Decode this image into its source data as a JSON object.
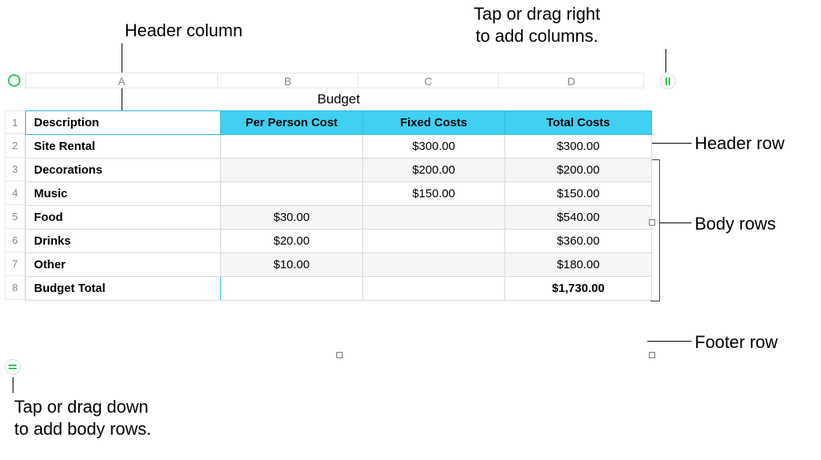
{
  "callouts": {
    "header_column": "Header column",
    "add_columns": "Tap or drag right\nto add columns.",
    "header_row": "Header row",
    "body_rows": "Body rows",
    "footer_row": "Footer row",
    "add_body_rows": "Tap or drag down\nto add body rows."
  },
  "column_letters": [
    "A",
    "B",
    "C",
    "D"
  ],
  "row_numbers": [
    "1",
    "2",
    "3",
    "4",
    "5",
    "6",
    "7",
    "8"
  ],
  "table": {
    "title": "Budget",
    "headers": {
      "description": "Description",
      "per_person": "Per Person Cost",
      "fixed": "Fixed Costs",
      "total": "Total Costs"
    },
    "rows": [
      {
        "desc": "Site Rental",
        "per_person": "",
        "fixed": "$300.00",
        "total": "$300.00"
      },
      {
        "desc": "Decorations",
        "per_person": "",
        "fixed": "$200.00",
        "total": "$200.00"
      },
      {
        "desc": "Music",
        "per_person": "",
        "fixed": "$150.00",
        "total": "$150.00"
      },
      {
        "desc": "Food",
        "per_person": "$30.00",
        "fixed": "",
        "total": "$540.00"
      },
      {
        "desc": "Drinks",
        "per_person": "$20.00",
        "fixed": "",
        "total": "$360.00"
      },
      {
        "desc": "Other",
        "per_person": "$10.00",
        "fixed": "",
        "total": "$180.00"
      }
    ],
    "footer": {
      "desc": "Budget Total",
      "per_person": "",
      "fixed": "",
      "total": "$1,730.00"
    }
  },
  "chart_data": {
    "type": "table",
    "title": "Budget",
    "columns": [
      "Description",
      "Per Person Cost",
      "Fixed Costs",
      "Total Costs"
    ],
    "rows": [
      [
        "Site Rental",
        null,
        300.0,
        300.0
      ],
      [
        "Decorations",
        null,
        200.0,
        200.0
      ],
      [
        "Music",
        null,
        150.0,
        150.0
      ],
      [
        "Food",
        30.0,
        null,
        540.0
      ],
      [
        "Drinks",
        20.0,
        null,
        360.0
      ],
      [
        "Other",
        10.0,
        null,
        180.0
      ]
    ],
    "footer": [
      "Budget Total",
      null,
      null,
      1730.0
    ]
  }
}
